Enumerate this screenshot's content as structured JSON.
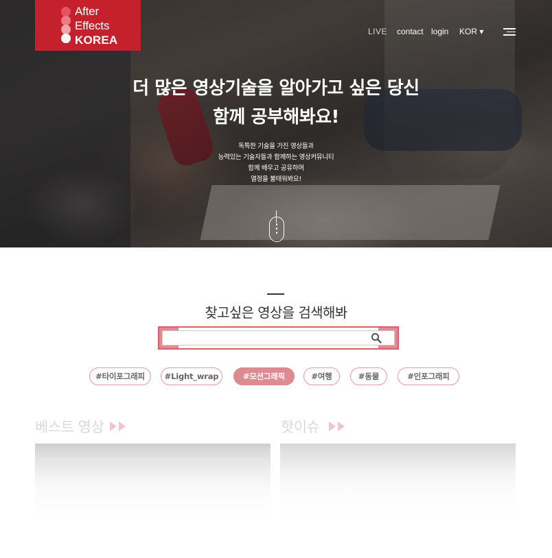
{
  "header": {
    "logo": {
      "line1": "After",
      "line2": "Effects",
      "line3": "KOREA",
      "dot_colors": [
        "#e55560",
        "#ec7b84",
        "#f3a3a9",
        "#ffffff"
      ]
    },
    "nav": {
      "live": "LIVE",
      "contact": "contact",
      "login": "login",
      "language": "KOR",
      "language_caret": "▾"
    },
    "menu_icon": "hamburger-menu-icon"
  },
  "hero": {
    "title_line1": "더 많은 영상기술을 알아가고 싶은 당신",
    "title_line2": "함께 공부해봐요!",
    "sub_lines": [
      "독특한 기술을 가진 영상들과",
      "능력있는 기술자들과 함께하는 영상커뮤니티",
      "함께 배우고 공유하며",
      "열정을 불태워봐요!"
    ],
    "scroll_icon": "scroll-mouse-icon"
  },
  "search": {
    "title": "찾고싶은 영상을 검색해봐",
    "value": "",
    "placeholder": "",
    "icon": "search-icon",
    "accent": "#d95f6a"
  },
  "tags": [
    {
      "label": "#타이포그래피",
      "active": false
    },
    {
      "label": "#Light_wrap",
      "active": false
    },
    {
      "label": "#모션그래픽",
      "active": true
    },
    {
      "label": "#여행",
      "active": false
    },
    {
      "label": "#동물",
      "active": false
    },
    {
      "label": "#인포그래피",
      "active": false
    }
  ],
  "sections": {
    "best": {
      "title": "베스트 영상",
      "arrow_icon": "double-play-arrow-icon"
    },
    "hot": {
      "title": "핫이슈",
      "arrow_icon": "double-play-arrow-icon"
    }
  },
  "colors": {
    "brand_red": "#c5212c",
    "tag_active": "#dd8a90",
    "tag_border": "#e29aa0"
  }
}
